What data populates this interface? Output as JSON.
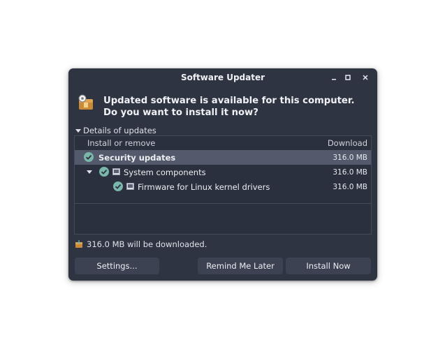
{
  "window": {
    "title": "Software Updater"
  },
  "header": {
    "message": "Updated software is available for this computer. Do you want to install it now?"
  },
  "details": {
    "label": "Details of updates"
  },
  "tree": {
    "columns": {
      "install": "Install or remove",
      "download": "Download"
    },
    "rows": [
      {
        "label": "Security updates",
        "size": "316.0 MB",
        "selected": true,
        "checked": true
      },
      {
        "label": "System components",
        "size": "316.0 MB",
        "checked": true
      },
      {
        "label": "Firmware for Linux kernel drivers",
        "size": "316.0 MB",
        "checked": true
      }
    ]
  },
  "summary": {
    "text": "316.0 MB will be downloaded."
  },
  "buttons": {
    "settings": "Settings...",
    "remind": "Remind Me Later",
    "install": "Install Now"
  },
  "colors": {
    "window_bg": "#2f3443",
    "selection": "#535a6b",
    "check_fill": "#7ab7aa",
    "button_bg": "#3c4252"
  },
  "icons": {
    "header": "package-updater-icon",
    "window": [
      "minimize-icon",
      "maximize-icon",
      "close-icon"
    ]
  }
}
